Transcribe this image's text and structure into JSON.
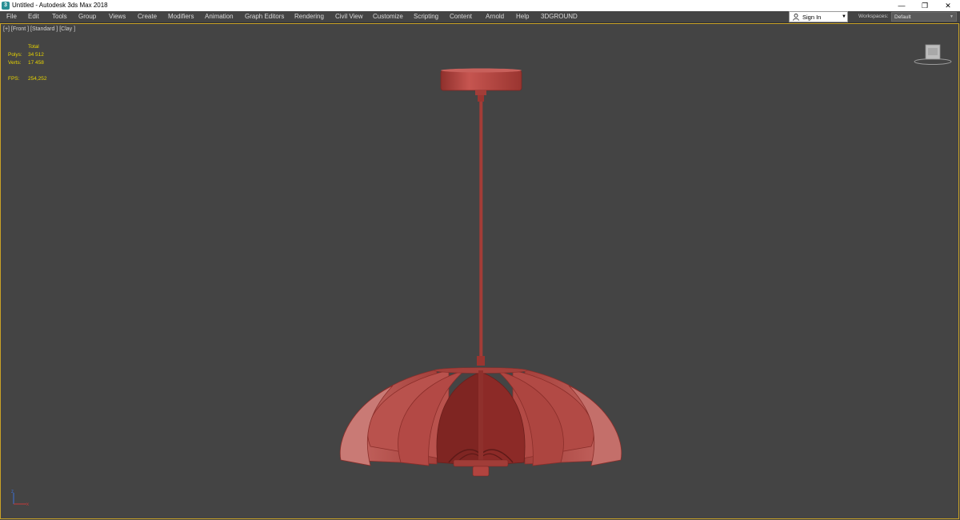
{
  "window": {
    "title": "Untitled - Autodesk 3ds Max 2018",
    "app_icon": "3",
    "controls": {
      "minimize": "—",
      "restore": "❐",
      "close": "✕"
    }
  },
  "menu": {
    "items": [
      "File",
      "Edit",
      "Tools",
      "Group",
      "Views",
      "Create",
      "Modifiers",
      "Animation",
      "Graph Editors",
      "Rendering",
      "Civil View",
      "Customize",
      "Scripting",
      "Content",
      "Arnold",
      "Help",
      "3DGROUND"
    ]
  },
  "account": {
    "sign_in_label": "Sign In"
  },
  "workspaces": {
    "label": "Workspaces:",
    "value": "Default"
  },
  "viewport": {
    "label": "[+] [Front ] [Standard ] [Clay ]",
    "stats": {
      "total_label": "Total",
      "polys_label": "Polys:",
      "polys_value": "34 512",
      "verts_label": "Verts:",
      "verts_value": "17 458",
      "fps_label": "FPS:",
      "fps_value": "254,252"
    },
    "colors": {
      "border": "#c9a227",
      "model": "#b84a44",
      "stats_text": "#e8d400"
    }
  }
}
